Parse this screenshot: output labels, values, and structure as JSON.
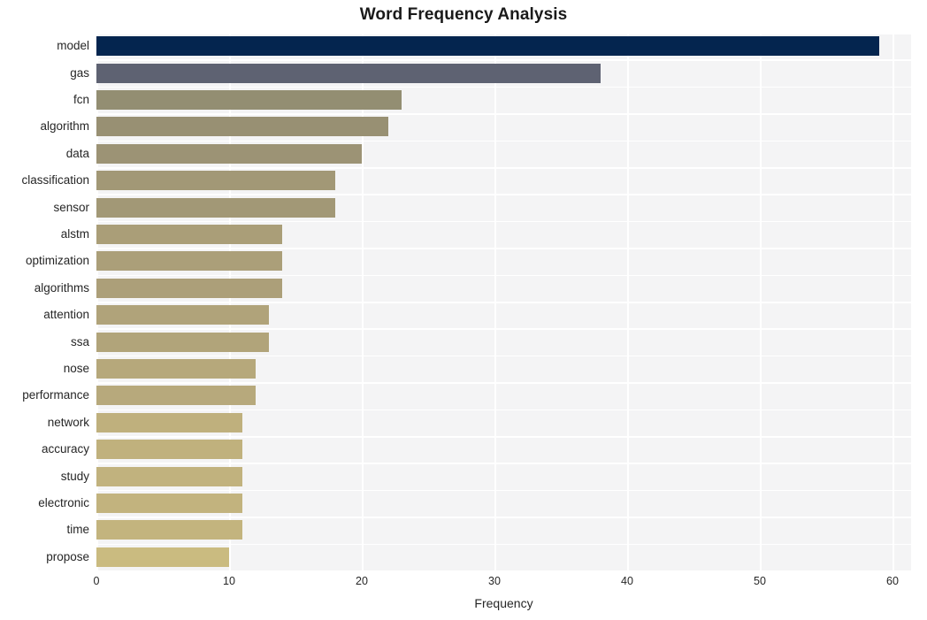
{
  "chart_data": {
    "type": "bar",
    "orientation": "horizontal",
    "title": "Word Frequency Analysis",
    "xlabel": "Frequency",
    "ylabel": "",
    "xlim": [
      0,
      60
    ],
    "xticks": [
      0,
      10,
      20,
      30,
      40,
      50,
      60
    ],
    "grid": true,
    "legend": "none",
    "categories": [
      "model",
      "gas",
      "fcn",
      "algorithm",
      "data",
      "classification",
      "sensor",
      "alstm",
      "optimization",
      "algorithms",
      "attention",
      "ssa",
      "nose",
      "performance",
      "network",
      "accuracy",
      "study",
      "electronic",
      "time",
      "propose"
    ],
    "values": [
      59,
      38,
      23,
      22,
      20,
      18,
      18,
      14,
      14,
      14,
      13,
      13,
      12,
      12,
      11,
      11,
      11,
      11,
      11,
      10
    ],
    "bar_colors": [
      "#04254f",
      "#5e6272",
      "#938e72",
      "#989073",
      "#9c9375",
      "#a29876",
      "#a29876",
      "#aa9e78",
      "#ab9f79",
      "#ac9f79",
      "#b0a37a",
      "#b1a47a",
      "#b6a87b",
      "#b7a97c",
      "#bfb07d",
      "#c0b17d",
      "#c1b27e",
      "#c2b37e",
      "#c3b47e",
      "#cabb80"
    ],
    "plot_background": "#f4f4f5",
    "gridline_color": "#ffffff",
    "title_color": "#1a1a1a",
    "axis_text_color": "#262626"
  }
}
